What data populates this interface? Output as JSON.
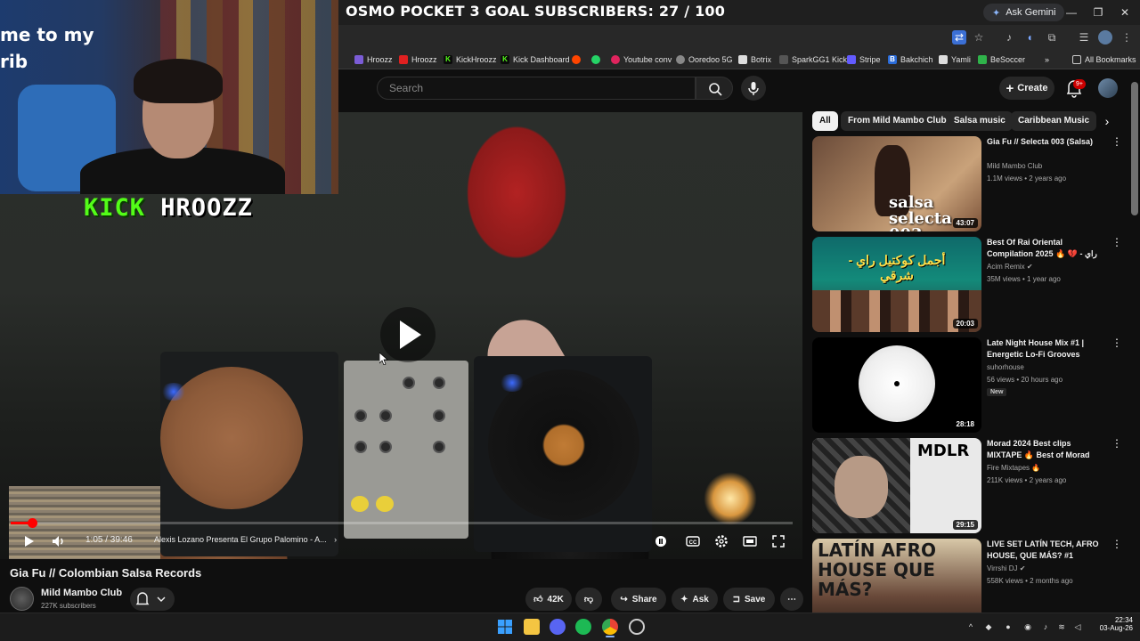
{
  "browser": {
    "overlay_title": "OSMO POCKET 3 GOAL SUBSCRIBERS: 27 / 100",
    "ask_gemini": "Ask Gemini",
    "bookmarks": [
      "Hroozz",
      "Hroozz",
      "KickHroozz",
      "Kick Dashboard",
      "",
      "",
      "Youtube conv",
      "Ooredoo 5G",
      "Botrix",
      "SparkGG1 Kick",
      "Stripe",
      "Bakchich",
      "Yamli",
      "BeSoccer"
    ],
    "all_bookmarks": "All Bookmarks"
  },
  "header": {
    "search_placeholder": "Search",
    "create_label": "Create",
    "notif_badge": "9+"
  },
  "overlay": {
    "webcam_text": "me to my\nrib",
    "kick": "KICK",
    "name": "HROOZZ"
  },
  "player": {
    "time": "1:05 / 39:46",
    "chapter": "Alexis Lozano Presenta El Grupo Palomino - A...",
    "progress": 0.027
  },
  "video": {
    "title": "Gia Fu // Colombian Salsa Records",
    "channel": "Mild Mambo Club",
    "subscribers": "227K subscribers",
    "likes": "42K",
    "share": "Share",
    "ask": "Ask",
    "save": "Save"
  },
  "chips": [
    "All",
    "From Mild Mambo Club",
    "Salsa music",
    "Caribbean Music"
  ],
  "recommendations": [
    {
      "title": "Gia Fu // Selecta 003 (Salsa)",
      "channel": "Mild Mambo Club",
      "meta": "1.1M views • 2 years ago",
      "duration": "43:07",
      "thumb_text": "salsa selecta 003",
      "badge": ""
    },
    {
      "title": "Best Of Rai Oriental Compilation 2025 🔥 راي - 💔 أجمل ريمكسات ...",
      "channel": "Acim Remix",
      "meta": "35M views • 1 year ago",
      "duration": "20:03",
      "thumb_text": "أجمل كوكتيل راي - شرقي",
      "badge": ""
    },
    {
      "title": "Late Night House Mix #1 | Energetic Lo-Fi Grooves",
      "channel": "suhorhouse",
      "meta": "56 views • 20 hours ago",
      "duration": "28:18",
      "thumb_text": "",
      "badge": "New"
    },
    {
      "title": "Morad 2024 Best clips MIXTAPE 🔥 Best of Morad",
      "channel": "Fire Mixtapes 🔥",
      "meta": "211K views • 2 years ago",
      "duration": "29:15",
      "thumb_text": "MDLR",
      "badge": ""
    },
    {
      "title": "LIVE SET LATÍN TECH, AFRO HOUSE, QUE MÁS? #1",
      "channel": "Virrshi DJ",
      "meta": "558K views • 2 months ago",
      "duration": "",
      "thumb_text": "LATÍN AFRO HOUSE QUE MÁS?",
      "badge": ""
    }
  ],
  "taskbar": {
    "time": "22:34",
    "date": "03-Aug-26"
  },
  "colors": {
    "accent": "#ff0000",
    "kick_green": "#53fc18",
    "bg": "#0f0f0f"
  }
}
